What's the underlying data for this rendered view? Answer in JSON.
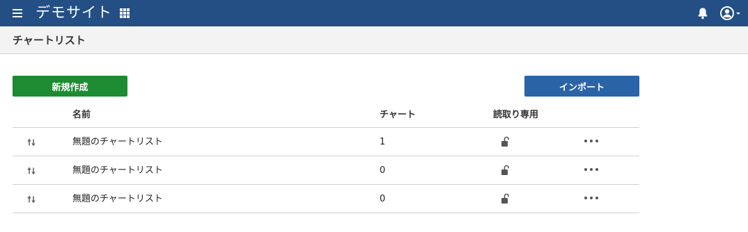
{
  "header": {
    "site_title": "デモサイト",
    "icons": {
      "menu": "hamburger-menu-icon",
      "apps": "apps-grid-icon",
      "notifications": "bell-icon",
      "user": "user-circle-icon"
    }
  },
  "page": {
    "title": "チャートリスト"
  },
  "toolbar": {
    "new_label": "新規作成",
    "import_label": "インポート"
  },
  "colors": {
    "header_bg": "#234f84",
    "new_button": "#1d8b31",
    "import_button": "#2b64a6"
  },
  "table": {
    "columns": [
      "名前",
      "チャート",
      "読取り専用"
    ],
    "rows": [
      {
        "name": "無題のチャートリスト",
        "charts": "1",
        "readonly_icon": "unlock-icon"
      },
      {
        "name": "無題のチャートリスト",
        "charts": "0",
        "readonly_icon": "unlock-icon"
      },
      {
        "name": "無題のチャートリスト",
        "charts": "0",
        "readonly_icon": "unlock-icon"
      }
    ]
  }
}
